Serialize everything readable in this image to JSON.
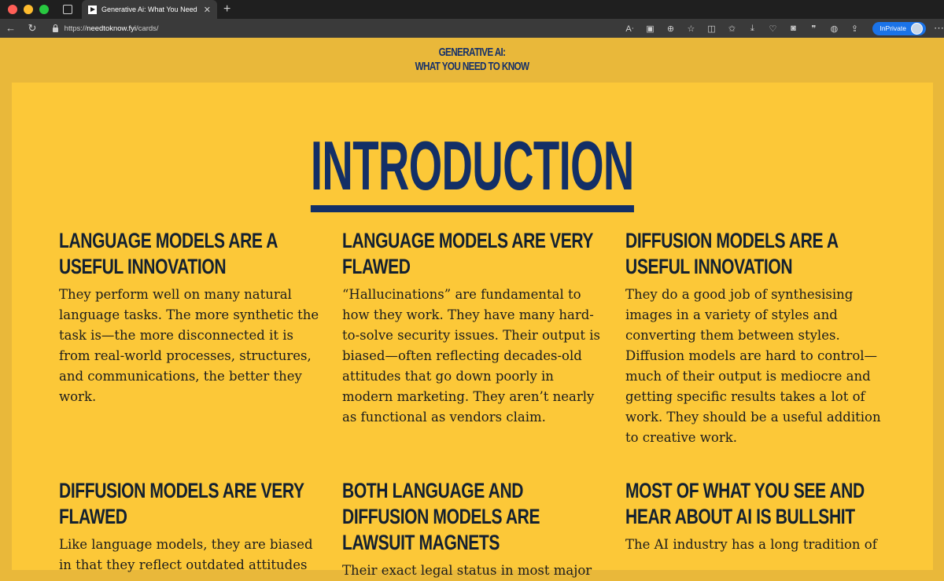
{
  "browser": {
    "tab_title": "Generative Ai: What You Need",
    "tab_close": "✕",
    "new_tab": "+",
    "url_scheme": "https://",
    "url_host": "needtoknow.fyi",
    "url_path": "/cards/",
    "inprivate_label": "InPrivate"
  },
  "site": {
    "logo_line1": "GENERATIVE AI:",
    "logo_line2": "WHAT YOU NEED TO KNOW"
  },
  "section": {
    "title": "INTRODUCTION"
  },
  "cards": [
    {
      "heading": "LANGUAGE MODELS ARE A USEFUL INNOVATION",
      "body": "They perform well on many natural language tasks. The more synthetic the task is—the more disconnected it is from real-world processes, structures, and communications, the better they work."
    },
    {
      "heading": "LANGUAGE MODELS ARE VERY FLAWED",
      "body": "“Hallucinations” are fundamental to how they work. They have many hard-to-solve security issues. Their output is biased—often reflecting decades-old attitudes that go down poorly in modern marketing. They aren’t nearly as functional as vendors claim."
    },
    {
      "heading": "DIFFUSION MODELS ARE A USEFUL INNOVATION",
      "body": "They do a good job of synthesising images in a variety of styles and converting them between styles. Diffusion models are hard to control—much of their output is mediocre and getting specific results takes a lot of work. They should be a useful addition to creative work."
    },
    {
      "heading": "DIFFUSION MODELS ARE VERY FLAWED",
      "body": "Like language models, they are biased in that they reflect outdated attitudes"
    },
    {
      "heading": "BOTH LANGUAGE AND DIFFUSION MODELS ARE LAWSUIT MAGNETS",
      "body": "Their exact legal status in most major"
    },
    {
      "heading": "MOST OF WHAT YOU SEE AND HEAR ABOUT AI IS BULLSHIT",
      "body": "The AI industry has a long tradition of"
    }
  ]
}
